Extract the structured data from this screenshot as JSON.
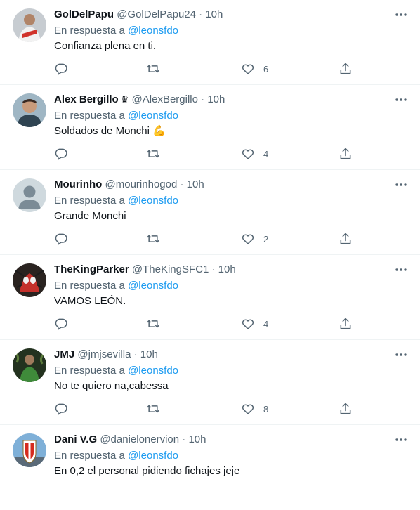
{
  "tweets": [
    {
      "name": "GolDelPapu",
      "handle": "@GolDelPapu24",
      "time": "10h",
      "reply_prefix": "En respuesta a",
      "reply_to": "@leonsfdo",
      "text": "Confianza plena en ti.",
      "likes": "6",
      "badge": "",
      "avatar": {
        "style": "photo-red",
        "bg": "#c7ccd1",
        "accent": "#d0332b"
      }
    },
    {
      "name": "Alex Bergillo",
      "handle": "@AlexBergillo",
      "time": "10h",
      "reply_prefix": "En respuesta a",
      "reply_to": "@leonsfdo",
      "text": "Soldados de Monchi 💪",
      "likes": "4",
      "badge": "♛",
      "avatar": {
        "style": "photo-person",
        "bg": "#9fb6c4",
        "accent": "#c89b7b"
      }
    },
    {
      "name": "Mourinho",
      "handle": "@mourinhogod",
      "time": "10h",
      "reply_prefix": "En respuesta a",
      "reply_to": "@leonsfdo",
      "text": "Grande Monchi",
      "likes": "2",
      "badge": "",
      "avatar": {
        "style": "default",
        "bg": "#cfd9de",
        "accent": "#7b8b96"
      }
    },
    {
      "name": "TheKingParker",
      "handle": "@TheKingSFC1",
      "time": "10h",
      "reply_prefix": "En respuesta a",
      "reply_to": "@leonsfdo",
      "text": "VAMOS LEÓN.",
      "likes": "4",
      "badge": "",
      "avatar": {
        "style": "photo-spider",
        "bg": "#2a2320",
        "accent": "#c4302b"
      }
    },
    {
      "name": "JMJ",
      "handle": "@jmjsevilla",
      "time": "10h",
      "reply_prefix": "En respuesta a",
      "reply_to": "@leonsfdo",
      "text": "No te quiero na,cabessa",
      "likes": "8",
      "badge": "",
      "avatar": {
        "style": "photo-dark",
        "bg": "#23321f",
        "accent": "#3f8a3a"
      }
    },
    {
      "name": "Dani V.G",
      "handle": "@danielonervion",
      "time": "10h",
      "reply_prefix": "En respuesta a",
      "reply_to": "@leonsfdo",
      "text": "En 0,2 el personal pidiendo fichajes jeje",
      "likes": "",
      "badge": "",
      "avatar": {
        "style": "crest",
        "bg": "#7fb0d8",
        "accent": "#d52b1e"
      }
    }
  ],
  "colors": {
    "text": "#0f1419",
    "secondary": "#536471",
    "link": "#1d9bf0",
    "divider": "#eff3f4"
  },
  "icons": [
    "more-icon",
    "reply-icon",
    "retweet-icon",
    "like-icon",
    "share-icon"
  ]
}
